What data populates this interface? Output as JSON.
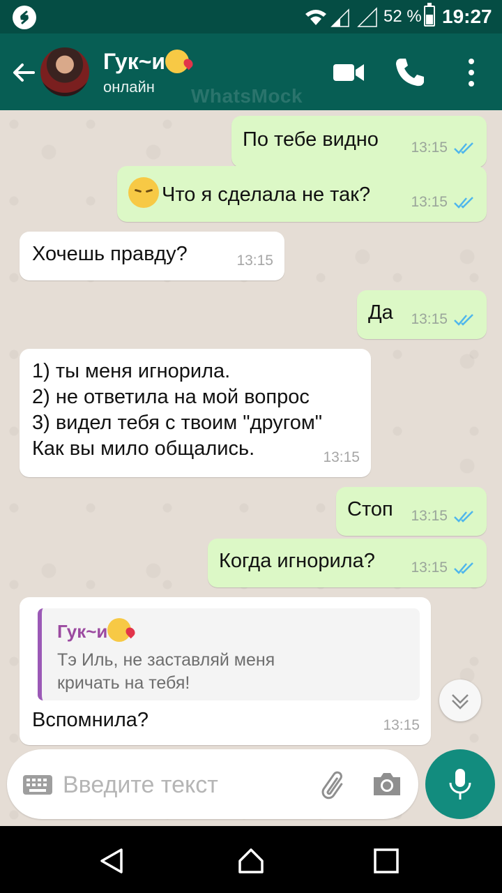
{
  "status_bar": {
    "battery_percent": "52 %",
    "battery_level": 0.52,
    "time": "19:27"
  },
  "header": {
    "contact_name": "Гук~и",
    "contact_status": "онлайн",
    "watermark": "WhatsMock"
  },
  "messages": [
    {
      "direction": "out",
      "text": "По тебе видно",
      "time": "13:15",
      "read": true
    },
    {
      "direction": "out",
      "text": "Что я сделала не так?",
      "emoji": "pensive-face",
      "time": "13:15",
      "read": true
    },
    {
      "direction": "in",
      "text": "Хочешь правду?",
      "time": "13:15"
    },
    {
      "direction": "out",
      "text": "Да",
      "time": "13:15",
      "read": true
    },
    {
      "direction": "in",
      "lines": [
        "1) ты меня игнорила.",
        "2) не ответила на мой вопрос",
        "3) видел тебя с твоим \"другом\"",
        "Как вы мило общались."
      ],
      "time": "13:15"
    },
    {
      "direction": "out",
      "text": "Стоп",
      "time": "13:15",
      "read": true
    },
    {
      "direction": "out",
      "text": "Когда игнорила?",
      "time": "13:15",
      "read": true
    },
    {
      "direction": "in",
      "quote": {
        "author": "Гук~и",
        "text_lines": [
          "Тэ Иль, не заставляй меня",
          "кричать на тебя!"
        ]
      },
      "text": "Вспомнила?",
      "time": "13:15"
    }
  ],
  "input": {
    "placeholder": "Введите текст"
  },
  "colors": {
    "header": "#075e54",
    "status_bar": "#054d44",
    "outgoing_bubble": "#dcf8c6",
    "incoming_bubble": "#ffffff",
    "read_ticks": "#4fb6ec",
    "mic_button": "#128c7e",
    "quote_accent": "#9b59b6"
  },
  "icons": [
    "shazam-icon",
    "wifi-icon",
    "signal-icon",
    "battery-icon",
    "back-arrow-icon",
    "video-call-icon",
    "phone-icon",
    "more-vert-icon",
    "double-check-icon",
    "chevron-down-icon",
    "keyboard-icon",
    "paperclip-icon",
    "camera-icon",
    "mic-icon",
    "nav-back-icon",
    "nav-home-icon",
    "nav-recents-icon"
  ]
}
